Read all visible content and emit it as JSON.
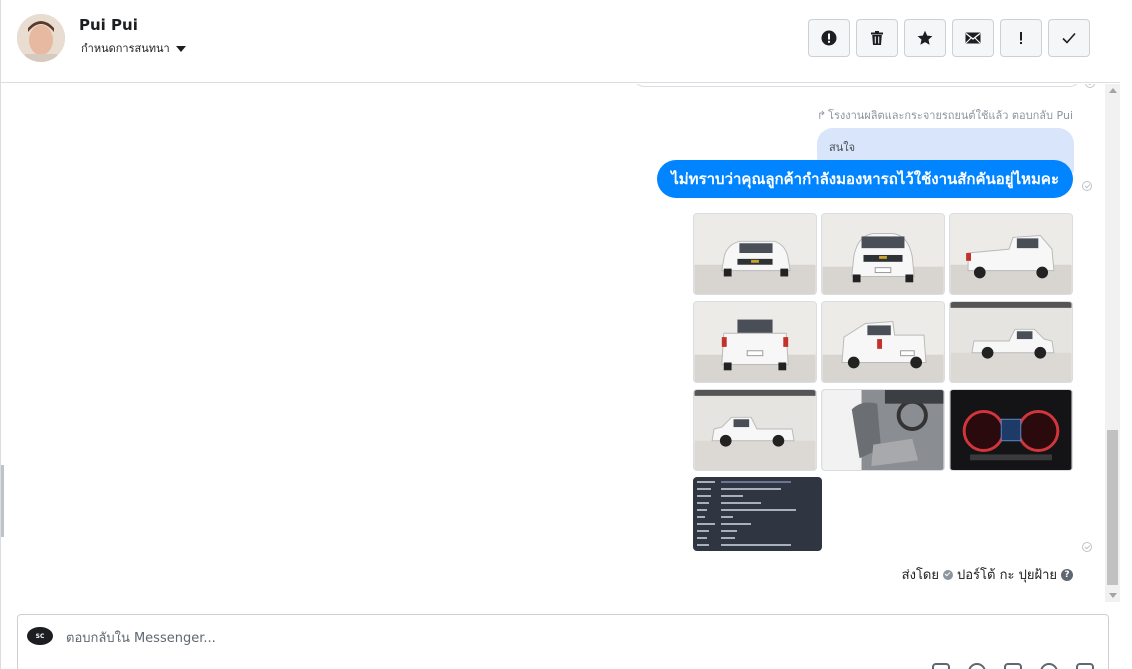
{
  "header": {
    "contact_name": "Pui Pui",
    "assign_label": "กำหนดการสนทนา",
    "toolbar": [
      {
        "name": "spam-button",
        "icon": "alert-circle-icon"
      },
      {
        "name": "delete-button",
        "icon": "trash-icon"
      },
      {
        "name": "star-button",
        "icon": "star-icon"
      },
      {
        "name": "mark-unread-button",
        "icon": "envelope-icon"
      },
      {
        "name": "follow-up-button",
        "icon": "exclamation-icon"
      },
      {
        "name": "mark-done-button",
        "icon": "checkmark-icon"
      }
    ]
  },
  "conversation": {
    "reply_note": "โรงงานผลิตและกระจายรถยนต์ใช้แล้ว ตอบกลับ Pui",
    "quoted_message": "สนใจ",
    "message_text": "ไม่ทราบว่าคุณลูกค้ากำลังมองหารถไว้ใช้งานสักคันอยู่ไหมคะ",
    "photos": [
      {
        "icon": "pickup-front-photo"
      },
      {
        "icon": "pickup-front-photo"
      },
      {
        "icon": "pickup-rear-photo"
      },
      {
        "icon": "pickup-rear-photo"
      },
      {
        "icon": "pickup-rear-photo"
      },
      {
        "icon": "pickup-side-photo"
      },
      {
        "icon": "pickup-side-photo"
      },
      {
        "icon": "car-interior-photo"
      },
      {
        "icon": "dashboard-photo"
      }
    ],
    "sent_by_label": "ส่งโดย",
    "sender_name": "ปอร์โต้ กะ ปุยฝ้าย"
  },
  "composer": {
    "placeholder": "ตอบกลับใน Messenger..."
  },
  "colors": {
    "accent": "#0084ff",
    "quoted_bg": "#d8e5fa"
  }
}
